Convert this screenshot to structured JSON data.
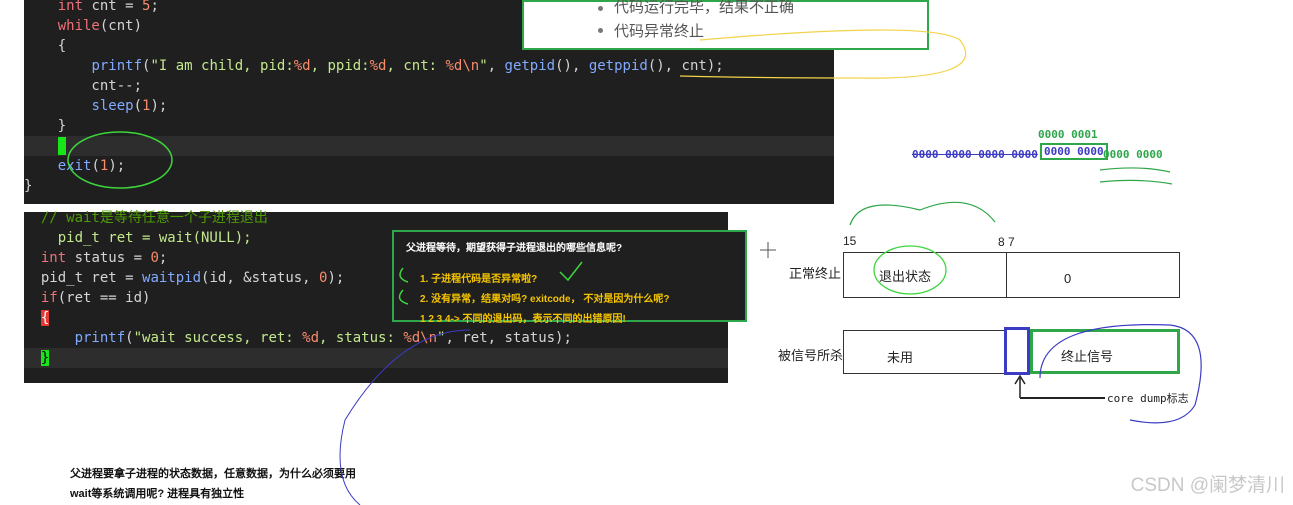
{
  "code_top": {
    "lines": [
      {
        "html": "    <span class='kw'>int</span> cnt = <span class='num'>5</span>;"
      },
      {
        "html": "    <span class='kw'>while</span>(cnt)"
      },
      {
        "html": "    {"
      },
      {
        "html": "        <span class='fn'>printf</span>(<span class='str'>\"I am child, pid:</span><span class='fmt'>%d</span><span class='str'>, ppid:</span><span class='fmt'>%d</span><span class='str'>, cnt: </span><span class='fmt'>%d\\n</span><span class='str'>\"</span>, <span class='fn'>getpid</span>(), <span class='fn'>getppid</span>(), cnt);"
      },
      {
        "html": "        cnt--;"
      },
      {
        "html": "        <span class='fn'>sleep</span>(<span class='num'>1</span>);"
      },
      {
        "html": "    }"
      },
      {
        "html": "    <span class='cursor'></span>",
        "highlight": true
      },
      {
        "html": "    <span class='fn'>exit</span>(<span class='num'>1</span>);"
      },
      {
        "html": "}"
      }
    ]
  },
  "code_bottom": {
    "lines": [
      {
        "html": "  <span class='cmt'>// wait是等待任意一个子进程退出</span>"
      },
      {
        "html": "    <span class='str'>pid_t ret = wait(NULL);</span>"
      },
      {
        "html": "  <span class='kw'>int</span> status = <span class='num'>0</span>;"
      },
      {
        "html": "  pid_t ret = <span class='fn'>waitpid</span>(id, &status, <span class='num'>0</span>);"
      },
      {
        "html": "  <span class='kw'>if</span>(ret == id)"
      },
      {
        "html": "  <span style='background:#e53935;color:#fff'>{</span>"
      },
      {
        "html": "      <span class='fn'>printf</span>(<span class='str'>\"wait success, ret: </span><span class='fmt'>%d</span><span class='str'>, status: </span><span class='fmt'>%d\\n</span><span class='str'>\"</span>, ret, status);"
      },
      {
        "html": "  <span style='background:#19e619;color:#000'>}</span>",
        "highlight": true
      }
    ]
  },
  "top_box": {
    "item1": "代码运行完毕，结果不正确",
    "item2": "代码异常终止"
  },
  "note": {
    "title": "父进程等待，期望获得子进程退出的哪些信息呢?",
    "q1": "1. 子进程代码是否异常啦?",
    "q2": "2. 没有异常，结果对吗? exitcode， 不对是因为什么呢?",
    "q3": "1 2 3 4-> 不同的退出码，表示不同的出错原因!"
  },
  "bits": {
    "top": "0000 0001",
    "row": "0000 0000 0000 0000",
    "mid": "0000 0000",
    "last": "0000 0000"
  },
  "diagram": {
    "bit15": "15",
    "bit87": "8 7",
    "normal_label": "正常终止",
    "exit_status": "退出状态",
    "zero": "0",
    "signal_label": "被信号所杀",
    "unused": "未用",
    "term_signal": "终止信号",
    "core_dump": "core dump标志"
  },
  "caption": {
    "line1": "父进程要拿子进程的状态数据，任意数据，为什么必须要用",
    "line2": "wait等系统调用呢? 进程具有独立性"
  },
  "watermark": "CSDN @阑梦清川"
}
